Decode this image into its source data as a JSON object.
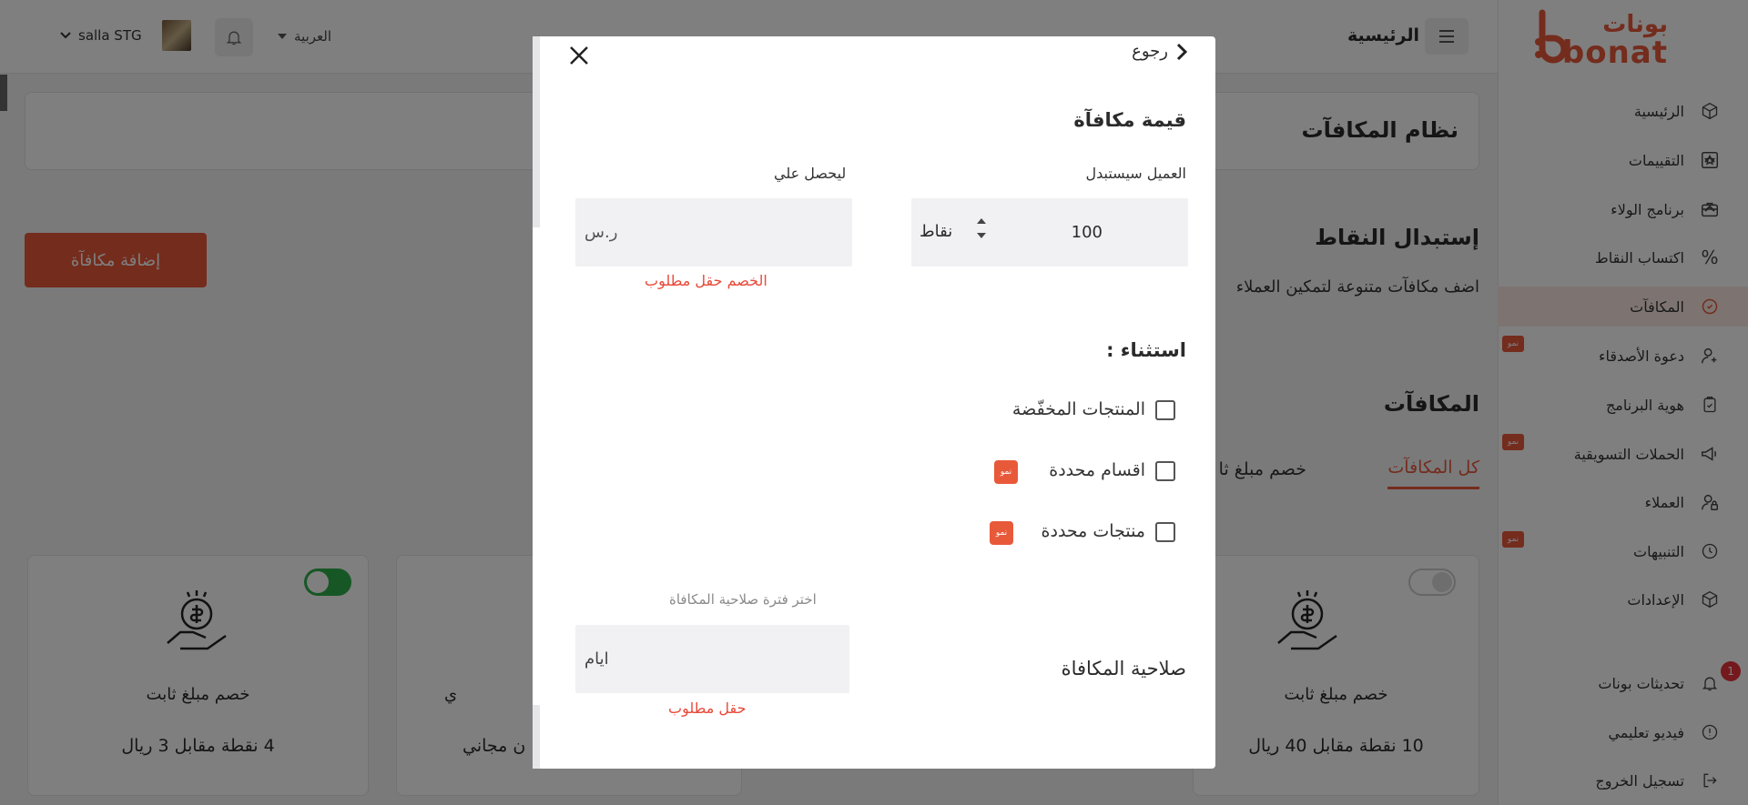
{
  "brand": {
    "arabic": "بونات",
    "latin": "bonat",
    "color": "#e8593a"
  },
  "sidebar": {
    "items": [
      {
        "label": "الرئيسية",
        "icon": "cube-icon"
      },
      {
        "label": "التقييمات",
        "icon": "star-icon"
      },
      {
        "label": "برنامج الولاء",
        "icon": "briefcase-icon"
      },
      {
        "label": "اكتساب النقاط",
        "icon": "percent-icon"
      },
      {
        "label": "المكافآت",
        "icon": "reward-icon"
      },
      {
        "label": "دعوة الأصدقاء",
        "icon": "user-plus-icon",
        "badge": "نمو"
      },
      {
        "label": "هوية البرنامج",
        "icon": "clipboard-icon"
      },
      {
        "label": "الحملات التسويقية",
        "icon": "megaphone-icon",
        "badge": "نمو"
      },
      {
        "label": "العملاء",
        "icon": "user-lock-icon"
      },
      {
        "label": "التنبيهات",
        "icon": "clock-icon",
        "badge": "نمو"
      },
      {
        "label": "الإعدادات",
        "icon": "cube-icon"
      }
    ],
    "footer": [
      {
        "label": "تحديثات بونات",
        "icon": "bell-icon",
        "count": "1"
      },
      {
        "label": "فيديو تعليمي",
        "icon": "info-icon"
      },
      {
        "label": "تسجيل الخروج",
        "icon": "logout-icon"
      }
    ]
  },
  "topbar": {
    "page_title": "الرئيسية",
    "language": "العربية",
    "store_name": "salla STG"
  },
  "main": {
    "section_title": "نظام المكافآت",
    "add_button": "إضافة مكافآة",
    "redeem_title": "إستبدال النقاط",
    "redeem_desc": "اضف مكافآت متنوعة لتمكين العملاء",
    "rewards_title": "المكافآت",
    "tabs": [
      "كل المكافآت",
      "خصم مبلغ ثا"
    ],
    "cards": [
      {
        "title": "خصم مبلغ ثابت",
        "desc": "10 نقطة مقابل 40 ريال",
        "toggle": "off"
      },
      {
        "title": "ي",
        "desc": "ن مجاني",
        "toggle": "hidden"
      },
      {
        "title": "خصم مبلغ ثابت",
        "desc": "4 نقطة مقابل 3 ريال",
        "toggle": "on"
      }
    ]
  },
  "modal": {
    "back_label": "رجوع",
    "reward_value_title": "قيمة مكافآة",
    "customer_redeems_label": "العميل سيستبدل",
    "points_value": "100",
    "points_unit": "نقاط",
    "gets_label": "ليحصل علي",
    "currency_placeholder": "ر.س",
    "discount_required": "الخصم حقل مطلوب",
    "exception_title": "استثناء :",
    "exceptions": [
      {
        "label": "المنتجات المخفّضة",
        "badge": ""
      },
      {
        "label": "اقسام محددة",
        "badge": "نمو"
      },
      {
        "label": "منتجات محددة",
        "badge": "نمو"
      }
    ],
    "validity_hint": "اختر فترة صلاحية المكافاة",
    "validity_title": "صلاحية المكافاة",
    "days_placeholder": "ايام",
    "field_required": "حقل مطلوب"
  }
}
